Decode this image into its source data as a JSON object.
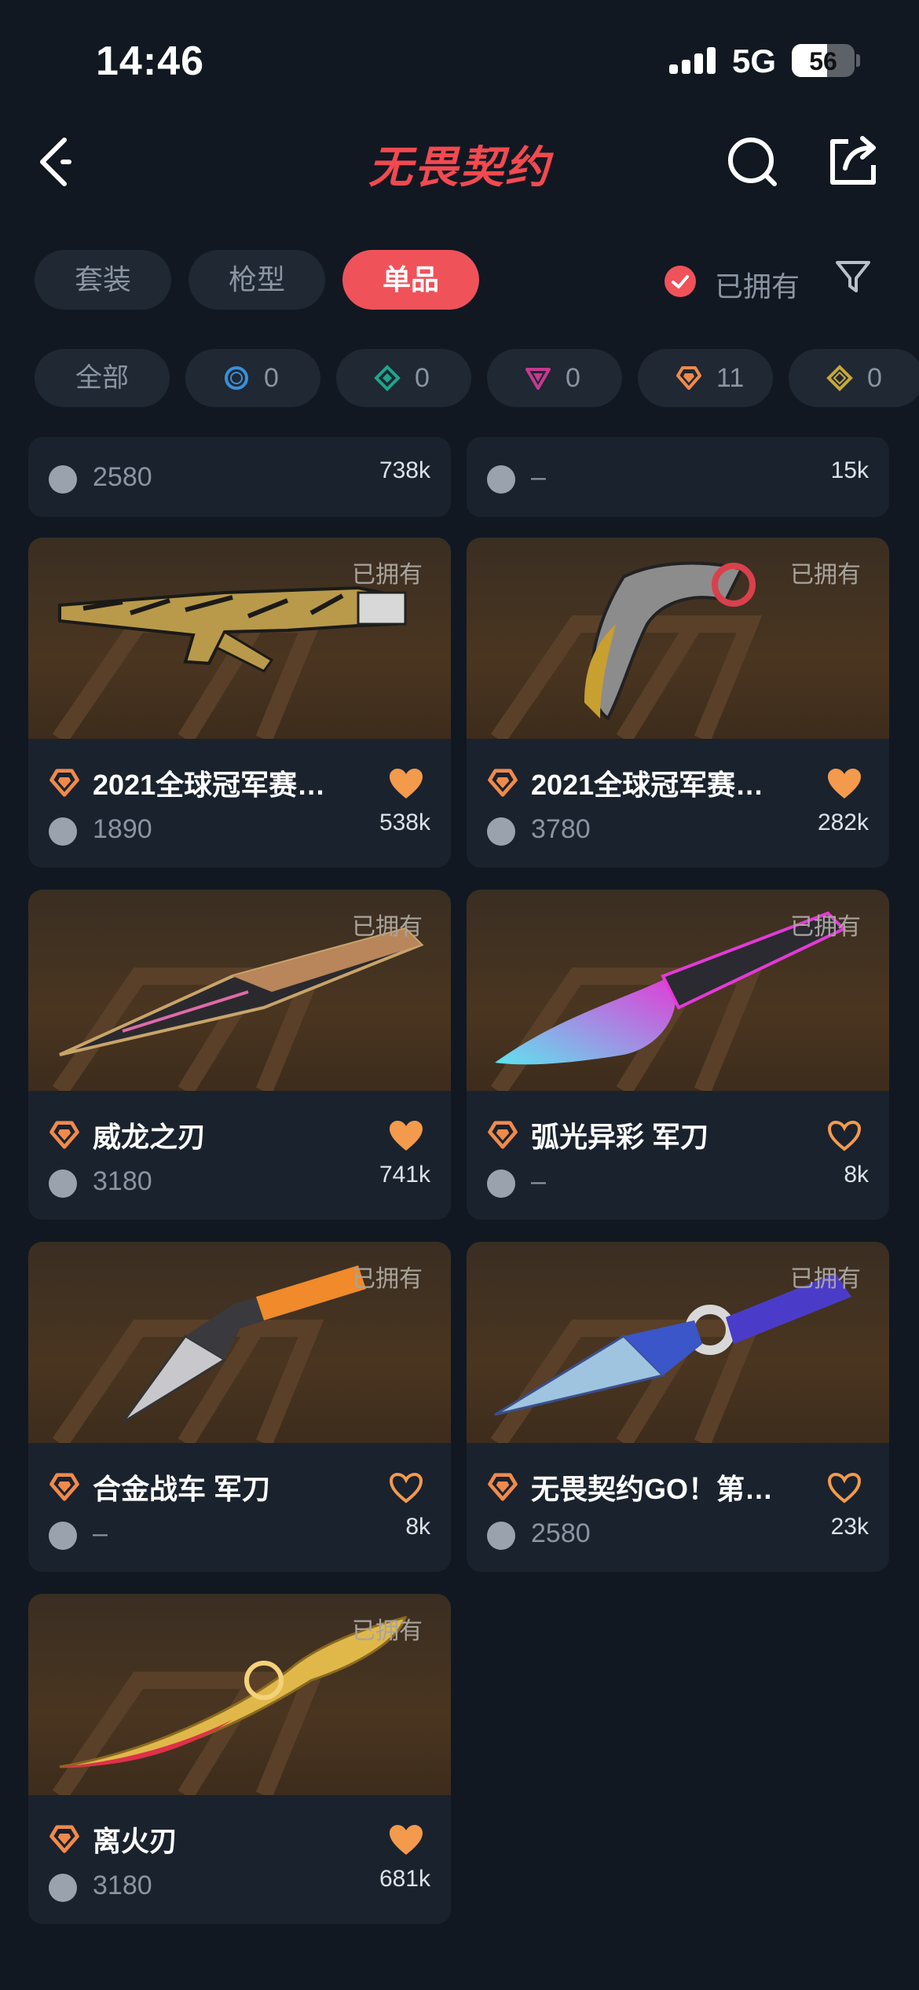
{
  "status_bar": {
    "time": "14:46",
    "network": "5G",
    "battery": "56"
  },
  "header": {
    "title": "无畏契约"
  },
  "tabs": [
    {
      "label": "套装",
      "active": false
    },
    {
      "label": "枪型",
      "active": false
    },
    {
      "label": "单品",
      "active": true
    }
  ],
  "owned_filter": {
    "label": "已拥有",
    "checked": true
  },
  "rarity_filters": [
    {
      "label": "全部"
    },
    {
      "count": "0",
      "icon": "select-tier-icon",
      "color": "#3a8fd8"
    },
    {
      "count": "0",
      "icon": "deluxe-tier-icon",
      "color": "#1fa58c"
    },
    {
      "count": "0",
      "icon": "premium-tier-icon",
      "color": "#c43a8f"
    },
    {
      "count": "11",
      "icon": "exclusive-tier-icon",
      "color": "#f08a4b"
    },
    {
      "count": "0",
      "icon": "ultra-tier-icon",
      "color": "#c8a83a"
    }
  ],
  "colors": {
    "accent": "#f0525a",
    "heart": "#f39a4c",
    "background": "#111822",
    "card": "#1a222d"
  },
  "items": [
    {
      "name": "",
      "price": "2580",
      "likes": "738k",
      "owned": "",
      "liked": true,
      "partial": true
    },
    {
      "name": "",
      "price": "–",
      "likes": "15k",
      "owned": "",
      "liked": true,
      "partial": true
    },
    {
      "name": "2021全球冠军赛…",
      "price": "1890",
      "likes": "538k",
      "owned": "已拥有",
      "liked": true,
      "art": "rifle"
    },
    {
      "name": "2021全球冠军赛…",
      "price": "3780",
      "likes": "282k",
      "owned": "已拥有",
      "liked": true,
      "art": "karambit"
    },
    {
      "name": "威龙之刃",
      "price": "3180",
      "likes": "741k",
      "owned": "已拥有",
      "liked": true,
      "art": "blade"
    },
    {
      "name": "弧光异彩 军刀",
      "price": "–",
      "likes": "8k",
      "owned": "已拥有",
      "liked": false,
      "art": "neon"
    },
    {
      "name": "合金战车 军刀",
      "price": "–",
      "likes": "8k",
      "owned": "已拥有",
      "liked": false,
      "art": "cleaver"
    },
    {
      "name": "无畏契约GO！第…",
      "price": "2580",
      "likes": "23k",
      "owned": "已拥有",
      "liked": false,
      "art": "kunai"
    },
    {
      "name": "离火刃",
      "price": "3180",
      "likes": "681k",
      "owned": "已拥有",
      "liked": true,
      "art": "flame"
    }
  ]
}
